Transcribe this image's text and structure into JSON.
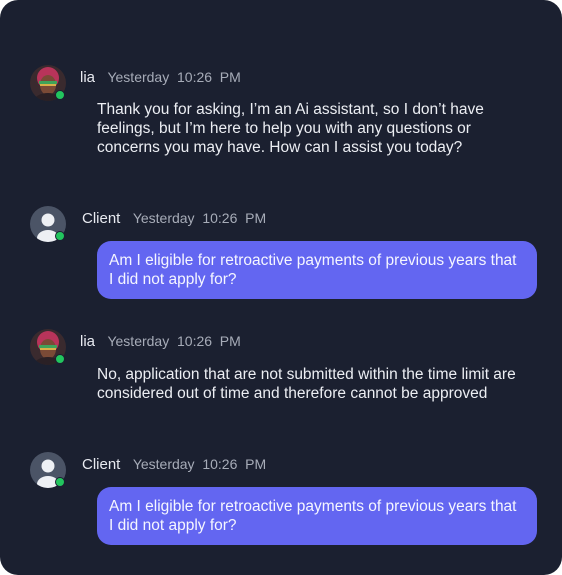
{
  "colors": {
    "background": "#1b2030",
    "bubble": "#6366f1",
    "online": "#22c55e"
  },
  "messages": [
    {
      "sender": "lia",
      "time": "Yesterday  10:26  PM",
      "avatar": "assistant-avatar",
      "text": "Thank  you for asking, I’m an Ai assistant, so I don’t have feelings, but I’m here to help you with any questions or concerns you may have. How can I assist you today?"
    },
    {
      "sender": "Client",
      "time": "Yesterday  10:26  PM",
      "avatar": "user-silhouette-icon",
      "text": "Am I eligible for retroactive payments of previous years that I did not apply for?"
    },
    {
      "sender": "lia",
      "time": "Yesterday  10:26  PM",
      "avatar": "assistant-avatar",
      "text": "No, application that are not submitted within the time limit are considered out of time and therefore cannot be approved"
    },
    {
      "sender": "Client",
      "time": "Yesterday  10:26  PM",
      "avatar": "user-silhouette-icon",
      "text": "Am I eligible for retroactive payments of previous years that I did not apply for?"
    }
  ]
}
